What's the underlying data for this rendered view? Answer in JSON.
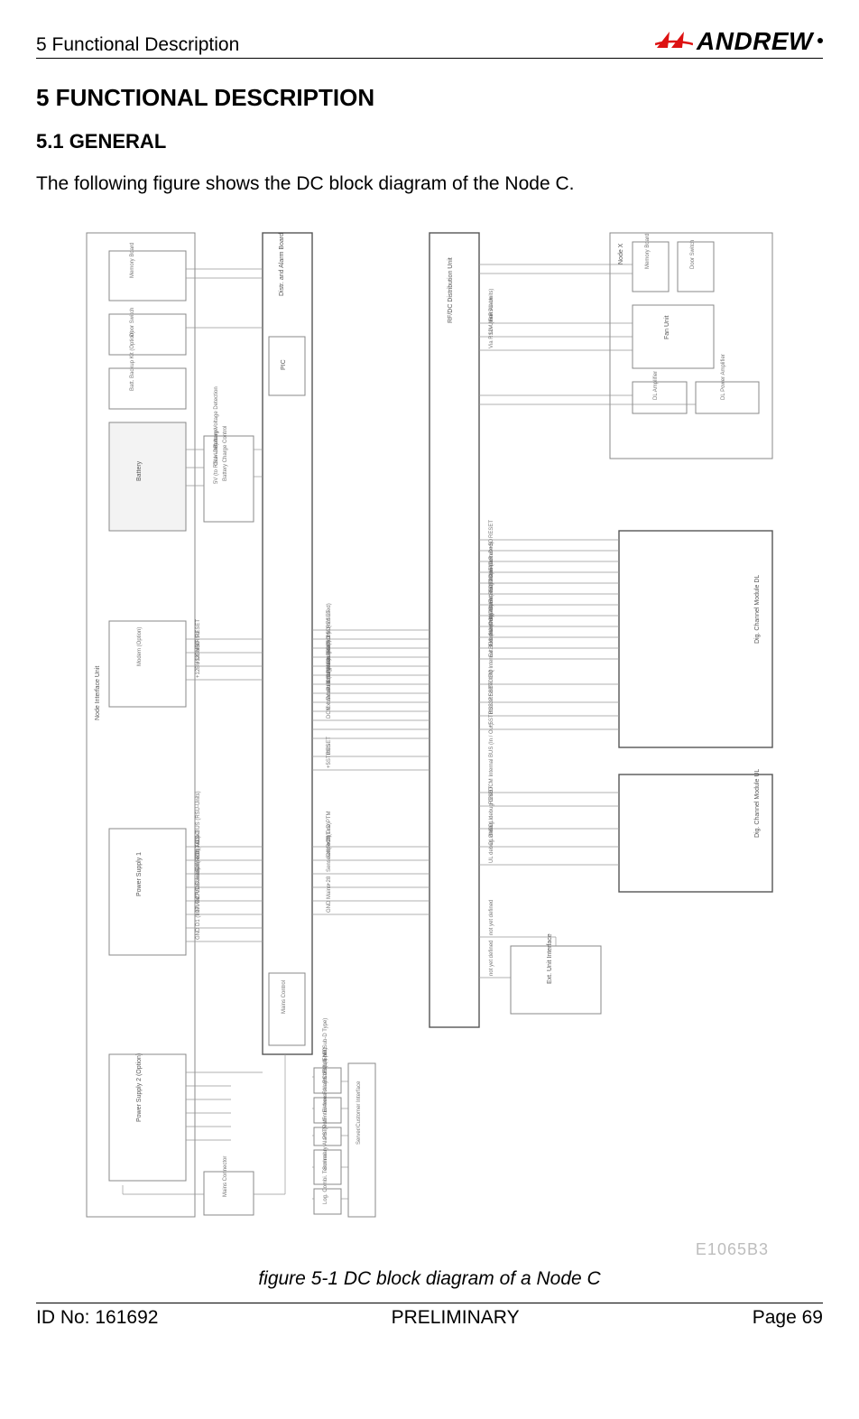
{
  "header": {
    "left": "5 Functional Description",
    "logo_text": "ANDREW"
  },
  "section": {
    "number_title": "5   FUNCTIONAL DESCRIPTION",
    "sub_number_title": "5.1    GENERAL",
    "paragraph": "The following figure shows the DC block diagram of the Node C."
  },
  "diagram": {
    "id_label": "E1065B3",
    "caption": "figure 5-1 DC block diagram of a Node C",
    "blocks": {
      "node_interface_unit": "Node Interface Unit",
      "node_x": "Node X",
      "memory_board_left": "Memory Board",
      "memory_board_right": "Memory Board",
      "door_switch_left": "Door Switch",
      "door_switch_right": "Door Switch",
      "batt_backup": "Batt. Backup Kit (Option)",
      "battery": "Battery",
      "battery_charge_control": "Battery Charge Control",
      "modem_option": "Modem (Option)",
      "power_supply_1": "Power Supply 1",
      "power_supply_2": "Power Supply 2 (Option)",
      "distr_alarm_board": "Distr. and Alarm Board",
      "pic": "PIC",
      "mains_control": "Mains Control",
      "rf_dc_distribution": "RF/DC Distribution Unit",
      "fan_unit": "Fan Unit",
      "dl_amplifier": "DL Amplifier",
      "dl_power_amplifier": "DL Power Amplifier",
      "dig_channel_module_dl": "Dig. Channel Module DL",
      "dig_channel_module_ul": "Dig. Channel Module UL",
      "ext_unit_interface": "Ext. Unit Interface",
      "server_customer_interface": "Server/Customer Interface",
      "mains_connector": "Mains Connector",
      "rs232_sub_d": "RS 232 (9-pin Sub-D Type)",
      "external_alarm": "External Alarm I/F (L-END)",
      "pstn": "PSTN I/F",
      "summary_alarm": "Summary Alarm (Potential-free Relay Contact) N O",
      "log_combi": "Log. Combi. Terminal"
    },
    "signals": [
      "RESET",
      "+5D",
      "RxD",
      "TxD",
      "Door Alarm",
      "Ext. Alarm In",
      "Ext. Alarm 2 In (not used)",
      "PSU Alarm (TxD)",
      "PSU Alarm (RxD)",
      "Summary Alarm",
      "Ext. Alarm 1 (out)",
      "Ext. Alarm 2 (out)",
      "DCM Internal BUS (In / Out)",
      "RESET",
      "+5STBUS",
      "+5",
      "+28 Line PTM",
      "RS232 Sniffer IRQ",
      "+28BUS",
      "+28",
      "Mains",
      "GND",
      "D1 (from via RSU-Units)",
      "ALA-BUS (RSU-Units)",
      "+5STA",
      "Switch-Status",
      "12V (to RSU-Units)",
      "Via RSU-Units",
      "Battery Voltage Detection",
      "Over-Discharge",
      "Fan Alarm",
      "Fan Alarm 1 (out)",
      "Fan Alarm 2 (out)",
      "Fan Alarm 2 (RxD)",
      "+12BUS/RSU",
      "+12BUS/GND",
      "5V (to RSU-Unit)",
      "Ext. AC/DC",
      "SenseOff(RxD)",
      "SenseOff(TxD)",
      "27VDC",
      "27VDC",
      "DL debug GND",
      "DL debug In",
      "UL debug GND",
      "UL debug In",
      "not yet defined"
    ]
  },
  "footer": {
    "left": "ID No: 161692",
    "center": "PRELIMINARY",
    "right": "Page 69"
  }
}
